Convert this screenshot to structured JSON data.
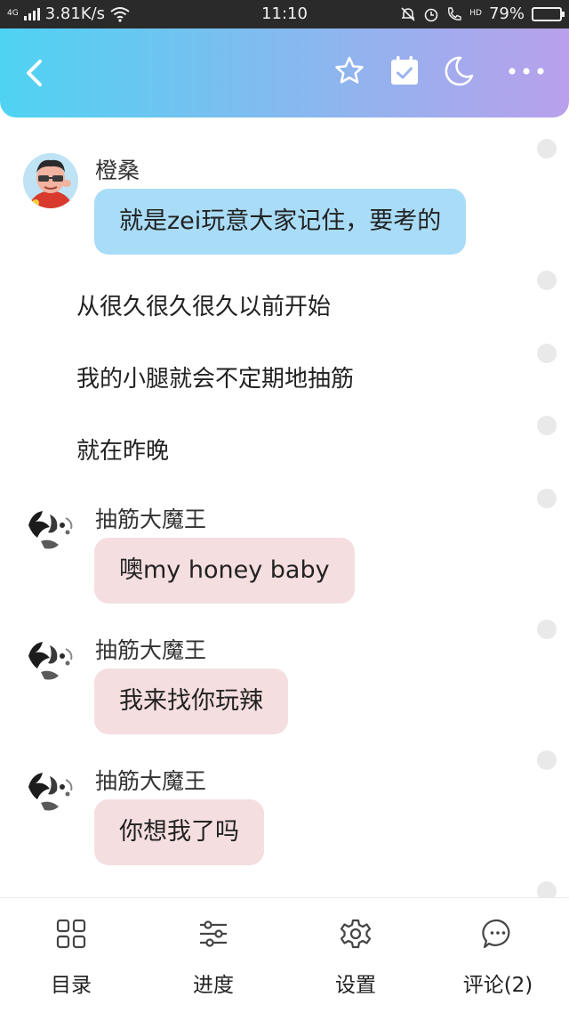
{
  "status_bar": {
    "network_type": "4G",
    "speed": "3.81K/s",
    "time": "11:10",
    "hd_label": "HD",
    "battery": "79%",
    "battery_level": 0.79
  },
  "header": {
    "gradient_start": "#4fd3f2",
    "gradient_end": "#b9a0ec",
    "icons": [
      "back-chevron-icon",
      "star-icon",
      "calendar-check-icon",
      "moon-icon",
      "more-icon"
    ]
  },
  "chat": {
    "messages": [
      {
        "type": "bubble",
        "sender": "橙桑",
        "text": "就是zei玩意大家记住，要考的",
        "color": "#a9dcf7"
      },
      {
        "type": "narration",
        "text": "从很久很久很久以前开始"
      },
      {
        "type": "narration",
        "text": "我的小腿就会不定期地抽筋"
      },
      {
        "type": "narration",
        "text": "就在昨晚"
      },
      {
        "type": "bubble",
        "sender": "抽筋大魔王",
        "text": "噢my honey baby",
        "color": "#f5dedf"
      },
      {
        "type": "bubble",
        "sender": "抽筋大魔王",
        "text": "我来找你玩辣",
        "color": "#f5dedf"
      },
      {
        "type": "bubble",
        "sender": "抽筋大魔王",
        "text": "你想我了吗",
        "color": "#f5dedf"
      }
    ]
  },
  "bottom_nav": {
    "items": [
      {
        "label": "目录",
        "icon": "grid-icon"
      },
      {
        "label": "进度",
        "icon": "sliders-icon"
      },
      {
        "label": "设置",
        "icon": "gear-icon"
      },
      {
        "label": "评论(2)",
        "icon": "comment-icon"
      }
    ]
  }
}
